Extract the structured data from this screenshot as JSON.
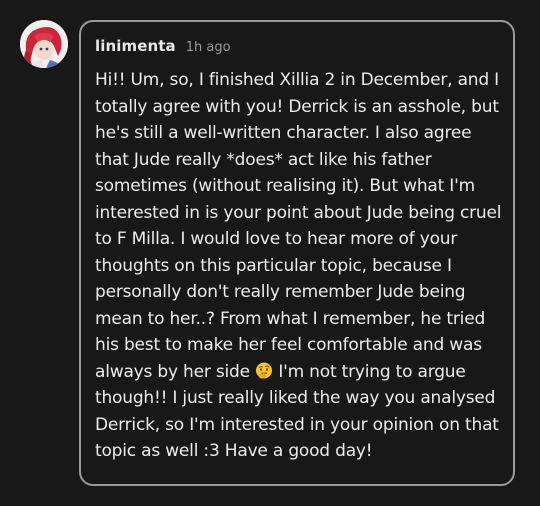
{
  "post": {
    "username": "linimenta",
    "timestamp": "1h ago",
    "body_before_emoji": "Hi!! Um, so, I finished Xillia 2 in December, and I totally agree with you! Derrick is an asshole, but he's still a well-written character. I also agree that Jude really *does* act like his father sometimes (without realising it). But what I'm interested in is your point about Jude being cruel to F Milla. I would love to hear more of your thoughts on this particular topic, because I personally don't really remember Jude being mean to her..? From what I remember, he tried his best to make her feel comfortable and was always by her side ",
    "emoji_icon": "thinking-face-emoji",
    "body_after_emoji": " I'm not trying to argue though!! I just really liked the way you analysed Derrick, so I'm interested in your opinion on that topic as well :3 Have a good day!"
  },
  "colors": {
    "background": "#181818",
    "bubble_border": "#9a9a9a",
    "text": "#ececec",
    "muted": "#9a9a9a"
  }
}
